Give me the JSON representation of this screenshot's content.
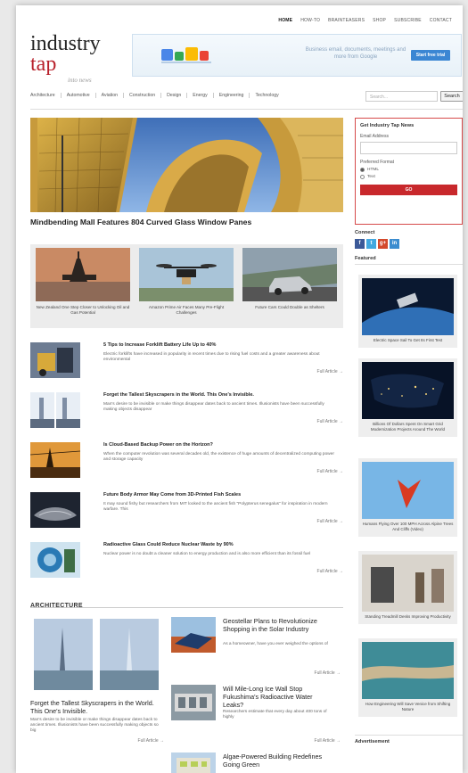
{
  "topnav": [
    "HOME",
    "HOW-TO",
    "BRAINTEASERS",
    "SHOP",
    "SUBSCRIBE",
    "CONTACT"
  ],
  "logo": {
    "line1": "industry",
    "line2": "tap",
    "tagline": "into news"
  },
  "banner": {
    "text": "Business email, documents, meetings and more from Google",
    "cta": "Start free trial"
  },
  "categories": [
    "Architecture",
    "Automotive",
    "Aviation",
    "Construction",
    "Design",
    "Energy",
    "Engineering",
    "Technology"
  ],
  "search": {
    "placeholder": "Search...",
    "button": "Search"
  },
  "hero": {
    "title": "Mindbending Mall Features 804 Curved Glass Window Panes"
  },
  "thumbs": [
    {
      "caption": "New Zealand One Step Closer to Unlocking Oil and Gas Potential"
    },
    {
      "caption": "Amazon Prime Air Faces Many Pre-Flight Challenges"
    },
    {
      "caption": "Future Cars Could Double as Shelters"
    }
  ],
  "articles": [
    {
      "title": "5 Tips to Increase Forklift Battery Life Up to 40%",
      "desc": "Electric forklifts have increased in popularity in recent times due to rising fuel costs and a greater awareness about environmental",
      "more": "Full Article →"
    },
    {
      "title": "Forget the Tallest Skyscrapers in the World. This One's Invisible.",
      "desc": "Man's desire to be invisible or make things disappear dates back to ancient times. Illusionists have been successfully making objects disappear",
      "more": "Full Article →"
    },
    {
      "title": "Is Cloud-Based Backup Power on the Horizon?",
      "desc": "When the computer revolution was several decades old, the existence of huge amounts of decentralized computing power and storage capacity",
      "more": "Full Article →"
    },
    {
      "title": "Future Body Armor May Come from 3D-Printed Fish Scales",
      "desc": "It may sound fishy but researchers from MIT looked to the ancient fish \"Polypterus senegalus\" for inspiration in modern warfare. This",
      "more": "Full Article →"
    },
    {
      "title": "Radioactive Glass Could Reduce Nuclear Waste by 90%",
      "desc": "Nuclear power is no doubt a cleaner solution to energy production and is also more efficient than its fossil fuel",
      "more": "Full Article →"
    }
  ],
  "section": {
    "title": "ARCHITECTURE"
  },
  "arch_left": {
    "title": "Forget the Tallest Skyscrapers in the World. This One's Invisible.",
    "desc": "Man's desire to be invisible or make things disappear dates back to ancient times. Illusionists have been successfully making objects so big",
    "more": "Full Article →"
  },
  "arch_right": [
    {
      "title": "Geostellar Plans to Revolutionize Shopping in the Solar Industry",
      "desc": "As a homeowner, have you ever weighed the options of",
      "more": "Full Article →"
    },
    {
      "title": "Will Mile-Long Ice Wall Stop Fukushima's Radioactive Water Leaks?",
      "desc": "Researchers estimate that every day about 400 tons of highly",
      "more": "Full Article →"
    },
    {
      "title": "Algae-Powered Building Redefines Going Green",
      "desc": "",
      "more": ""
    }
  ],
  "signup": {
    "title": "Get Industry Tap News",
    "email_label": "Email Address",
    "format_label": "Preferred Format",
    "opt_html": "HTML",
    "opt_text": "Text",
    "button": "GO"
  },
  "connect": {
    "title": "Connect",
    "icons": [
      "f",
      "t",
      "g+",
      "in"
    ]
  },
  "featured": {
    "title": "Featured",
    "items": [
      {
        "caption": "Electric Space Sail To Get Its First Test"
      },
      {
        "caption": "Billions Of Dollars Spent On Smart Grid Modernization Projects Around The World"
      },
      {
        "caption": "Humans Flying Over 100 MPH Across Alpine Trees And Cliffs (Video)"
      },
      {
        "caption": "Standing Treadmill Desks Improving Productivity"
      },
      {
        "caption": "How Engineering Will Save Venice from Shifting Nature"
      }
    ]
  },
  "advertisement": "Advertisement",
  "colors": {
    "accent": "#b8202a",
    "button": "#c8282c",
    "facebook": "#3b5998",
    "twitter": "#42a8e0",
    "gplus": "#d3492c",
    "linkedin": "#3b8ccf"
  }
}
